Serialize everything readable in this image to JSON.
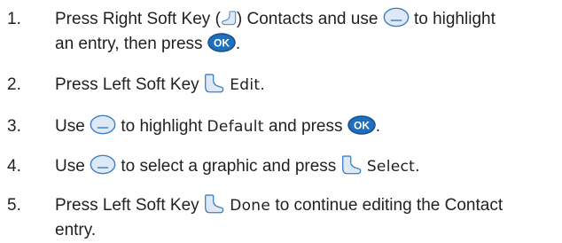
{
  "icons": {
    "right_soft_key": "right-soft-key-icon",
    "left_soft_key": "left-soft-key-icon",
    "navigation_key": "navigation-key-icon",
    "ok_key": "ok-key-icon"
  },
  "colors": {
    "text": "#231f20",
    "icon_fill": "#dfe9f5",
    "icon_stroke": "#3b7fc4",
    "ok_fill": "#1f6fbf"
  },
  "steps": [
    {
      "number": "1.",
      "t1": "Press Right Soft Key (",
      "t2": ") Contacts and use",
      "t3": "to highlight",
      "t4": "an entry, then press",
      "t5": "."
    },
    {
      "number": "2.",
      "t1": "Press Left Soft Key",
      "t2": "Edit."
    },
    {
      "number": "3.",
      "t1": "Use",
      "t2": "to highlight",
      "t3": "Default",
      "t4": "and press",
      "t5": "."
    },
    {
      "number": "4.",
      "t1": "Use",
      "t2": "to select a graphic and press",
      "t3": "Select."
    },
    {
      "number": "5.",
      "t1": "Press Left Soft Key",
      "t2": "Done",
      "t3": "to continue editing the Contact",
      "t4": "entry."
    }
  ],
  "ok_label": "OK"
}
